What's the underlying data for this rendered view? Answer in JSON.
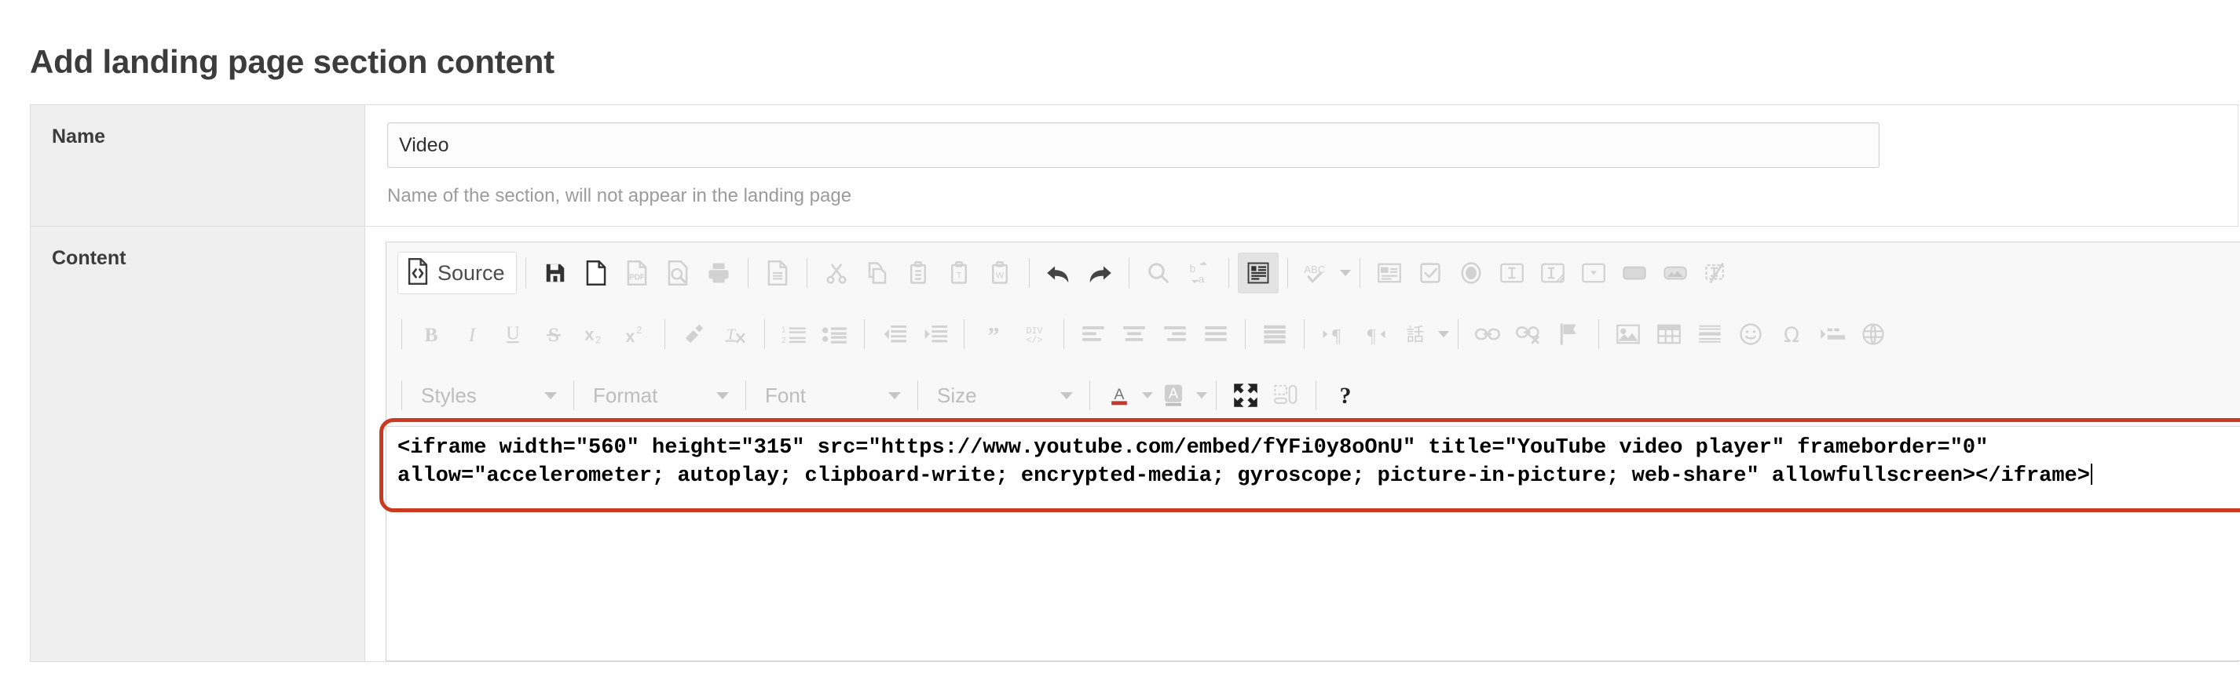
{
  "page": {
    "title": "Add landing page section content"
  },
  "form": {
    "name_row": {
      "label": "Name",
      "value": "Video",
      "placeholder": "",
      "help": "Name of the section, will not appear in the landing page"
    },
    "content_row": {
      "label": "Content"
    }
  },
  "editor": {
    "source_button": {
      "label": "Source",
      "icon": "source-code-icon",
      "active": true
    },
    "row1": [
      {
        "name": "save-icon",
        "label": "Save",
        "state": "enabled"
      },
      {
        "name": "new-page-icon",
        "label": "New Page",
        "state": "enabled"
      },
      {
        "name": "pdf-icon",
        "label": "Export to PDF",
        "state": "disabled"
      },
      {
        "name": "preview-icon",
        "label": "Preview",
        "state": "disabled"
      },
      {
        "name": "print-icon",
        "label": "Print",
        "state": "disabled"
      },
      {
        "name": "templates-icon",
        "label": "Templates",
        "state": "disabled"
      },
      {
        "name": "cut-icon",
        "label": "Cut",
        "state": "disabled"
      },
      {
        "name": "copy-icon",
        "label": "Copy",
        "state": "disabled"
      },
      {
        "name": "paste-icon",
        "label": "Paste",
        "state": "disabled"
      },
      {
        "name": "paste-as-plain-text-icon",
        "label": "Paste as plain text",
        "state": "disabled"
      },
      {
        "name": "paste-from-word-icon",
        "label": "Paste from Word",
        "state": "disabled"
      },
      {
        "name": "undo-icon",
        "label": "Undo",
        "state": "enabled"
      },
      {
        "name": "redo-icon",
        "label": "Redo",
        "state": "enabled"
      },
      {
        "name": "find-icon",
        "label": "Find",
        "state": "disabled"
      },
      {
        "name": "replace-icon",
        "label": "Replace",
        "state": "disabled"
      },
      {
        "name": "select-all-icon",
        "label": "Select All",
        "state": "enabled"
      },
      {
        "name": "spell-check-icon",
        "label": "ABC",
        "state": "disabled",
        "has_dropdown": true
      },
      {
        "name": "form-icon",
        "label": "Form",
        "state": "disabled"
      },
      {
        "name": "checkbox-icon",
        "label": "Checkbox",
        "state": "disabled"
      },
      {
        "name": "radio-button-icon",
        "label": "Radio Button",
        "state": "disabled"
      },
      {
        "name": "text-field-icon",
        "label": "Text Field",
        "state": "disabled"
      },
      {
        "name": "textarea-icon",
        "label": "Textarea",
        "state": "disabled"
      },
      {
        "name": "selection-field-icon",
        "label": "Selection Field",
        "state": "disabled"
      },
      {
        "name": "button-icon",
        "label": "Button",
        "state": "disabled"
      },
      {
        "name": "image-button-icon",
        "label": "Image Button",
        "state": "disabled"
      },
      {
        "name": "hidden-field-icon",
        "label": "Hidden Field",
        "state": "disabled"
      }
    ],
    "row2": [
      {
        "name": "bold-icon",
        "label": "B",
        "state": "disabled"
      },
      {
        "name": "italic-icon",
        "label": "I",
        "state": "disabled"
      },
      {
        "name": "underline-icon",
        "label": "U",
        "state": "disabled"
      },
      {
        "name": "strikethrough-icon",
        "label": "S",
        "state": "disabled"
      },
      {
        "name": "subscript-icon",
        "label": "x2",
        "state": "disabled"
      },
      {
        "name": "superscript-icon",
        "label": "x2",
        "state": "disabled"
      },
      {
        "name": "copy-formatting-icon",
        "label": "Copy Formatting",
        "state": "disabled"
      },
      {
        "name": "remove-format-icon",
        "label": "Remove Format",
        "state": "disabled"
      },
      {
        "name": "numbered-list-icon",
        "label": "Insert/Remove Numbered List",
        "state": "disabled"
      },
      {
        "name": "bulleted-list-icon",
        "label": "Insert/Remove Bulleted List",
        "state": "disabled"
      },
      {
        "name": "decrease-indent-icon",
        "label": "Decrease Indent",
        "state": "disabled"
      },
      {
        "name": "increase-indent-icon",
        "label": "Increase Indent",
        "state": "disabled"
      },
      {
        "name": "blockquote-icon",
        "label": "Block Quote",
        "state": "disabled"
      },
      {
        "name": "create-div-icon",
        "label": "DIV",
        "state": "disabled"
      },
      {
        "name": "align-left-icon",
        "label": "Align Left",
        "state": "disabled"
      },
      {
        "name": "align-center-icon",
        "label": "Center",
        "state": "disabled"
      },
      {
        "name": "align-right-icon",
        "label": "Align Right",
        "state": "disabled"
      },
      {
        "name": "justify-icon",
        "label": "Justify",
        "state": "disabled"
      },
      {
        "name": "text-direction-ltr-icon",
        "label": "Text direction left to right",
        "state": "disabled"
      },
      {
        "name": "text-direction-rtl-icon",
        "label": "Text direction right to left",
        "state": "disabled"
      },
      {
        "name": "language-icon",
        "label": "Set Language",
        "state": "disabled",
        "has_dropdown": true
      },
      {
        "name": "link-icon",
        "label": "Link",
        "state": "disabled"
      },
      {
        "name": "unlink-icon",
        "label": "Unlink",
        "state": "disabled"
      },
      {
        "name": "anchor-icon",
        "label": "Anchor",
        "state": "disabled"
      },
      {
        "name": "image-icon",
        "label": "Image",
        "state": "disabled"
      },
      {
        "name": "table-icon",
        "label": "Table",
        "state": "disabled"
      },
      {
        "name": "horizontal-rule-icon",
        "label": "Horizontal Line",
        "state": "disabled"
      },
      {
        "name": "smiley-icon",
        "label": "Smiley",
        "state": "disabled"
      },
      {
        "name": "special-character-icon",
        "label": "Insert Special Character",
        "state": "disabled"
      },
      {
        "name": "page-break-icon",
        "label": "Page Break",
        "state": "disabled"
      },
      {
        "name": "iframe-icon",
        "label": "IFrame",
        "state": "disabled"
      }
    ],
    "row3": {
      "combos": [
        {
          "name": "styles-combo",
          "label": "Styles"
        },
        {
          "name": "format-combo",
          "label": "Format"
        },
        {
          "name": "font-combo",
          "label": "Font"
        },
        {
          "name": "size-combo",
          "label": "Size"
        }
      ],
      "buttons": [
        {
          "name": "text-color-icon",
          "label": "Text Color",
          "state": "disabled",
          "has_dropdown": true
        },
        {
          "name": "background-color-icon",
          "label": "Background Color",
          "state": "disabled",
          "has_dropdown": true
        },
        {
          "name": "maximize-icon",
          "label": "Maximize",
          "state": "enabled"
        },
        {
          "name": "show-blocks-icon",
          "label": "Show Blocks",
          "state": "disabled"
        },
        {
          "name": "about-icon",
          "label": "?",
          "state": "enabled"
        }
      ]
    },
    "source_code": "<iframe width=\"560\" height=\"315\" src=\"https://www.youtube.com/embed/fYFi0y8oOnU\" title=\"YouTube video player\" frameborder=\"0\" allow=\"accelerometer; autoplay; clipboard-write; encrypted-media; gyroscope; picture-in-picture; web-share\" allowfullscreen></iframe>"
  },
  "annotation": {
    "name": "red-highlight-box",
    "color": "#ca3a20"
  },
  "colors": {
    "page_background": "#ffffff",
    "row_background": "#efefef",
    "toolbar_background": "#f8f8f8",
    "border": "#dddddd",
    "title_text": "#3c3c3c",
    "help_text": "#9b9b9b",
    "annotation_red": "#ca3a20"
  }
}
